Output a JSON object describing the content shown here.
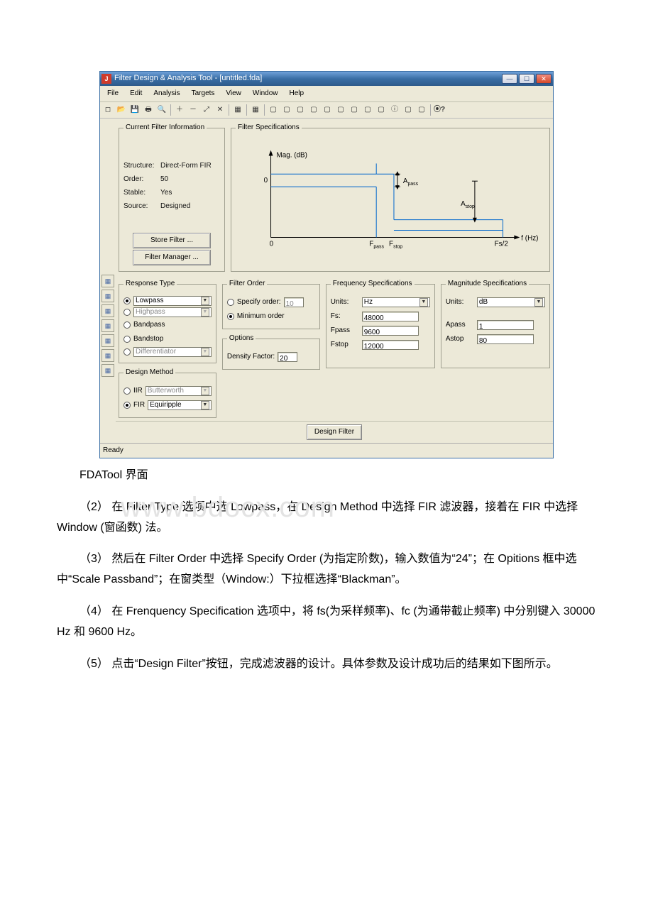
{
  "window": {
    "title": "Filter Design & Analysis Tool - [untitled.fda]",
    "icon_glyph": "J"
  },
  "menu": [
    "File",
    "Edit",
    "Analysis",
    "Targets",
    "View",
    "Window",
    "Help"
  ],
  "toolbar_icons": [
    "new",
    "open",
    "save",
    "print",
    "print-preview",
    "|",
    "zoom-in",
    "zoom-out",
    "zoom-fit",
    "zoom-reset",
    "|",
    "filter",
    "analyze",
    "|",
    "mag",
    "phase",
    "group-delay",
    "impulse",
    "step",
    "pole-zero",
    "coef",
    "round",
    "quantize",
    "info",
    "filter-info",
    "export",
    "|",
    "context-help"
  ],
  "status": "Ready",
  "info": {
    "legend": "Current Filter Information",
    "rows": [
      {
        "k": "Structure:",
        "v": "Direct-Form FIR"
      },
      {
        "k": "Order:",
        "v": "50"
      },
      {
        "k": "Stable:",
        "v": "Yes"
      },
      {
        "k": "Source:",
        "v": "Designed"
      }
    ],
    "store_btn": "Store Filter ...",
    "manager_btn": "Filter Manager ..."
  },
  "spec": {
    "legend": "Filter Specifications",
    "ylabel": "Mag. (dB)",
    "zero": "0",
    "apass": "A",
    "apass_sub": "pass",
    "astop": "A",
    "astop_sub": "stop",
    "fpass": "F",
    "fpass_sub": "pass",
    "fstop": "F",
    "fstop_sub": "stop",
    "fs2": "Fs/2",
    "xlabel": "f (Hz)"
  },
  "response": {
    "legend": "Response Type",
    "options": [
      {
        "label": "Lowpass",
        "selected": true,
        "dropdown": true
      },
      {
        "label": "Highpass",
        "selected": false,
        "dropdown": true
      },
      {
        "label": "Bandpass",
        "selected": false,
        "dropdown": false
      },
      {
        "label": "Bandstop",
        "selected": false,
        "dropdown": false
      },
      {
        "label": "Differentiator",
        "selected": false,
        "dropdown": true
      }
    ]
  },
  "design_method": {
    "legend": "Design Method",
    "iir_label": "IIR",
    "iir_value": "Butterworth",
    "iir_selected": false,
    "fir_label": "FIR",
    "fir_value": "Equiripple",
    "fir_selected": true
  },
  "filter_order": {
    "legend": "Filter Order",
    "specify_label": "Specify order:",
    "specify_value": "10",
    "specify_selected": false,
    "minimum_label": "Minimum order",
    "minimum_selected": true
  },
  "options": {
    "legend": "Options",
    "density_label": "Density Factor:",
    "density_value": "20"
  },
  "freq": {
    "legend": "Frequency Specifications",
    "units_label": "Units:",
    "units_value": "Hz",
    "rows": [
      {
        "k": "Fs:",
        "v": "48000"
      },
      {
        "k": "Fpass",
        "v": "9600"
      },
      {
        "k": "Fstop",
        "v": "12000"
      }
    ]
  },
  "mag": {
    "legend": "Magnitude Specifications",
    "units_label": "Units:",
    "units_value": "dB",
    "rows": [
      {
        "k": "Apass",
        "v": "1"
      },
      {
        "k": "Astop",
        "v": "80"
      }
    ]
  },
  "design_filter_btn": "Design Filter",
  "chart_data": {
    "type": "line",
    "title": "Filter Specifications",
    "xlabel": "f (Hz)",
    "ylabel": "Mag. (dB)",
    "x_ticks": [
      "0",
      "F_pass",
      "F_stop",
      "Fs/2"
    ],
    "y_ticks": [
      "0"
    ],
    "annotations": [
      "A_pass",
      "A_stop"
    ],
    "series": [
      {
        "name": "mask_upper",
        "points": [
          [
            0,
            1
          ],
          [
            0.38,
            1
          ],
          [
            0.38,
            1.2
          ],
          [
            0.45,
            1.2
          ],
          [
            0.45,
            -2.5
          ],
          [
            1,
            -2.5
          ]
        ]
      },
      {
        "name": "mask_lower",
        "points": [
          [
            0,
            -1
          ],
          [
            0.38,
            -1
          ],
          [
            0.38,
            -3.5
          ],
          [
            1,
            -3.5
          ]
        ]
      }
    ],
    "ylim": [
      -4,
      2
    ]
  },
  "body": {
    "caption": "FDATool 界面",
    "p2": "（2） 在 Filter Type 选项中选 Lowpass，在 Design Method 中选择 FIR 滤波器，接着在 FIR 中选择 Window (窗函数) 法。",
    "p3": "（3） 然后在 Filter Order 中选择 Specify Order (为指定阶数)，输入数值为“24”；在 Opitions 框中选中“Scale Passband”；在窗类型（Window:）下拉框选择“Blackman”。",
    "p4": "（4） 在 Frenquency Specification 选项中，将 fs(为采样频率)、fc (为通带截止频率) 中分别键入 30000 Hz 和 9600 Hz。",
    "p5": "（5） 点击“Design Filter”按钮，完成滤波器的设计。具体参数及设计成功后的结果如下图所示。",
    "watermark": "www.bdocx.com"
  }
}
